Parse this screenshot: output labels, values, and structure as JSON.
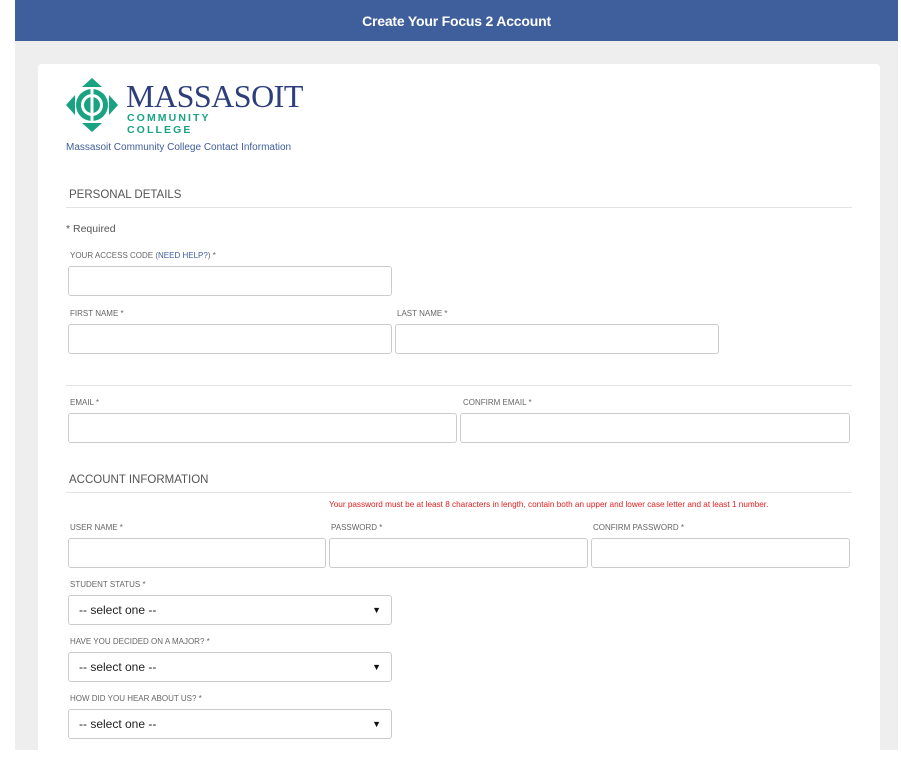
{
  "header": {
    "title": "Create Your Focus 2 Account"
  },
  "logo": {
    "name": "MASSASOIT",
    "subname": "COMMUNITY COLLEGE",
    "brand_color": "#2c3f7c",
    "accent_color": "#1aa382"
  },
  "contact_link": "Massasoit Community College Contact Information",
  "personal": {
    "title": "PERSONAL DETAILS",
    "required_note": "* Required",
    "access_code_label": "YOUR ACCESS CODE (",
    "need_help": "NEED HELP?",
    "access_code_suffix": ") *",
    "first_name_label": "FIRST NAME *",
    "last_name_label": "LAST NAME *",
    "email_label": "EMAIL *",
    "confirm_email_label": "CONFIRM EMAIL *"
  },
  "account": {
    "title": "ACCOUNT INFORMATION",
    "password_note": "Your password must be at least 8 characters in length, contain both an upper and lower case letter and at least 1 number.",
    "username_label": "USER NAME *",
    "password_label": "PASSWORD *",
    "confirm_password_label": "CONFIRM PASSWORD *",
    "student_status_label": "STUDENT STATUS *",
    "student_status_value": "-- select one --",
    "major_label": "HAVE YOU DECIDED ON A MAJOR? *",
    "major_value": "-- select one --",
    "hear_label": "HOW DID YOU HEAR ABOUT US? *",
    "hear_value": "-- select one --"
  },
  "colors": {
    "header_bg": "#3f5e9c",
    "error_text": "#e02020",
    "page_bg": "#eeeeee"
  }
}
